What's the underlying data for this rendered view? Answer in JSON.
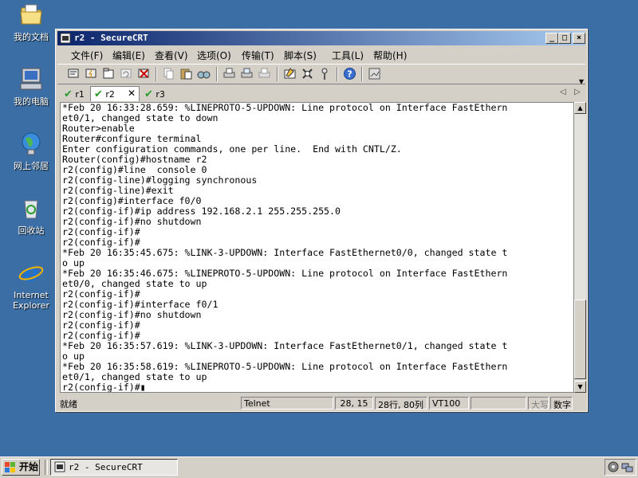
{
  "desktop": {
    "icons": [
      {
        "label": "我的文档",
        "icon": "my-documents-icon"
      },
      {
        "label": "我的电脑",
        "icon": "my-computer-icon"
      },
      {
        "label": "网上邻居",
        "icon": "network-places-icon"
      },
      {
        "label": "回收站",
        "icon": "recycle-bin-icon"
      },
      {
        "label": "Internet Explorer",
        "icon": "internet-explorer-icon"
      }
    ]
  },
  "window": {
    "title": "r2 - SecureCRT",
    "controls": {
      "minimize": "_",
      "maximize": "□",
      "close": "×"
    }
  },
  "menu": [
    "文件(F)",
    "编辑(E)",
    "查看(V)",
    "选项(O)",
    "传输(T)",
    "脚本(S)",
    "工具(L)",
    "帮助(H)"
  ],
  "toolbar_icons": [
    "connect-icon",
    "quick-connect-icon",
    "connect-in-tab-icon",
    "reconnect-icon",
    "disconnect-icon",
    "copy-icon",
    "paste-icon",
    "find-icon",
    "print-icon",
    "print-selection-icon",
    "print-setup-icon",
    "session-options-icon",
    "global-options-icon",
    "keymap-icon",
    "help-icon",
    "sftp-icon"
  ],
  "tabs": [
    {
      "label": "r1",
      "active": false
    },
    {
      "label": "r2",
      "active": true,
      "close": "✕"
    },
    {
      "label": "r3",
      "active": false
    }
  ],
  "tab_nav": {
    "prev": "◁",
    "next": "▷"
  },
  "terminal": {
    "lines": [
      "*Feb 20 16:33:28.659: %LINEPROTO-5-UPDOWN: Line protocol on Interface FastEthern",
      "et0/1, changed state to down",
      "Router>enable",
      "Router#configure terminal",
      "Enter configuration commands, one per line.  End with CNTL/Z.",
      "Router(config)#hostname r2",
      "r2(config)#line  console 0",
      "r2(config-line)#logging synchronous",
      "r2(config-line)#exit",
      "r2(config)#interface f0/0",
      "r2(config-if)#ip address 192.168.2.1 255.255.255.0",
      "r2(config-if)#no shutdown",
      "r2(config-if)#",
      "r2(config-if)#",
      "*Feb 20 16:35:45.675: %LINK-3-UPDOWN: Interface FastEthernet0/0, changed state t",
      "o up",
      "*Feb 20 16:35:46.675: %LINEPROTO-5-UPDOWN: Line protocol on Interface FastEthern",
      "et0/0, changed state to up",
      "r2(config-if)#",
      "r2(config-if)#interface f0/1",
      "r2(config-if)#no shutdown",
      "r2(config-if)#",
      "r2(config-if)#",
      "*Feb 20 16:35:57.619: %LINK-3-UPDOWN: Interface FastEthernet0/1, changed state t",
      "o up",
      "*Feb 20 16:35:58.619: %LINEPROTO-5-UPDOWN: Line protocol on Interface FastEthern",
      "et0/1, changed state to up",
      "r2(config-if)#"
    ],
    "cursor": "▮"
  },
  "statusbar": {
    "ready": "就绪",
    "protocol": "Telnet",
    "position": "28, 15",
    "size": "28行, 80列",
    "emulation": "VT100",
    "caps": "大写",
    "num": "数字"
  },
  "taskbar": {
    "start": "开始",
    "task": "r2 - SecureCRT"
  }
}
